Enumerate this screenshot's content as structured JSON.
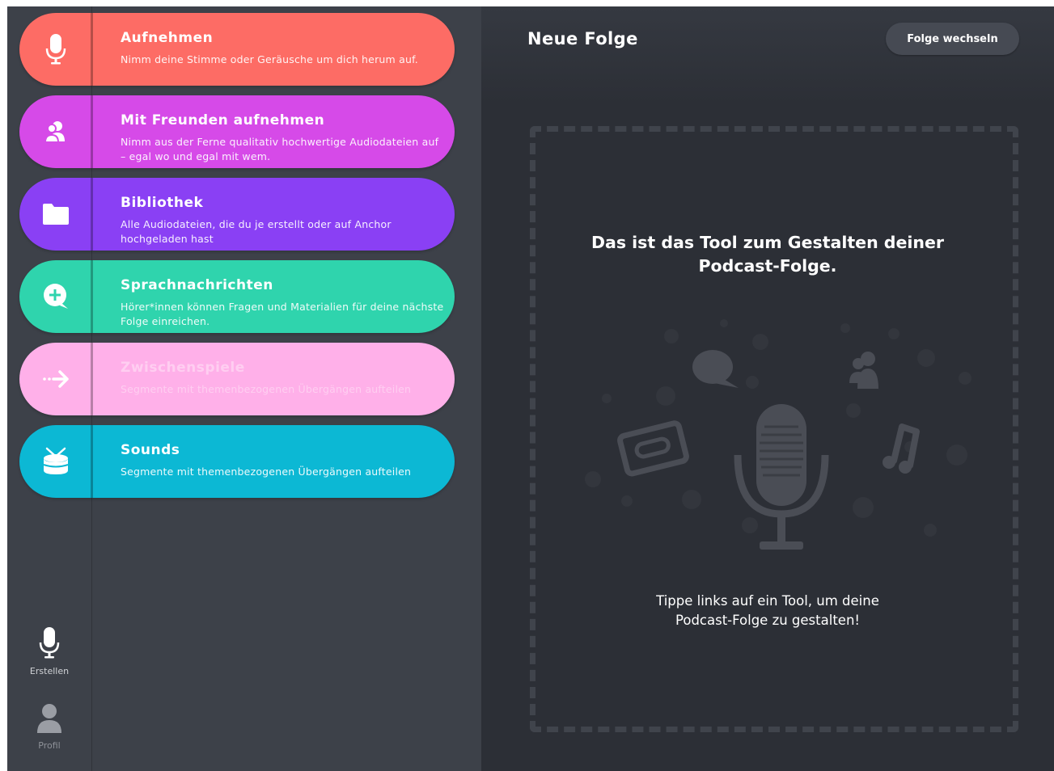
{
  "tools": [
    {
      "id": "record",
      "icon": "microphone-icon",
      "color": "#fd6c65",
      "title": "Aufnehmen",
      "description": "Nimm deine Stimme oder Geräusche um dich herum auf."
    },
    {
      "id": "friends",
      "icon": "people-icon",
      "color": "#d64ae8",
      "title": "Mit Freunden aufnehmen",
      "description": "Nimm aus der Ferne qualitativ hochwertige Audiodateien auf – egal wo und egal mit wem."
    },
    {
      "id": "library",
      "icon": "folder-icon",
      "color": "#8a40f4",
      "title": "Bibliothek",
      "description": "Alle Audiodateien, die du je erstellt oder auf Anchor hochgeladen hast"
    },
    {
      "id": "voice-messages",
      "icon": "chat-plus-icon",
      "color": "#2fd4ad",
      "title": "Sprachnachrichten",
      "description": "Hörer*innen können Fragen und Materialien für deine nächste Folge einreichen."
    },
    {
      "id": "interludes",
      "icon": "arrow-right-icon",
      "color": "#ffb0e9",
      "title": "Zwischenspiele",
      "description": "Segmente mit themenbezogenen Übergängen aufteilen"
    },
    {
      "id": "sounds",
      "icon": "drum-icon",
      "color": "#0cb8d4",
      "title": "Sounds",
      "description": "Segmente mit themenbezogenen Übergängen aufteilen"
    }
  ],
  "nav": {
    "create_label": "Erstellen",
    "profile_label": "Profil"
  },
  "header": {
    "title": "Neue Folge",
    "switch_button": "Folge wechseln"
  },
  "dropzone": {
    "heading": "Das ist das Tool zum Gestalten deiner Podcast-Folge.",
    "hint": "Tippe links auf ein Tool, um deine Podcast-Folge zu gestalten!"
  }
}
